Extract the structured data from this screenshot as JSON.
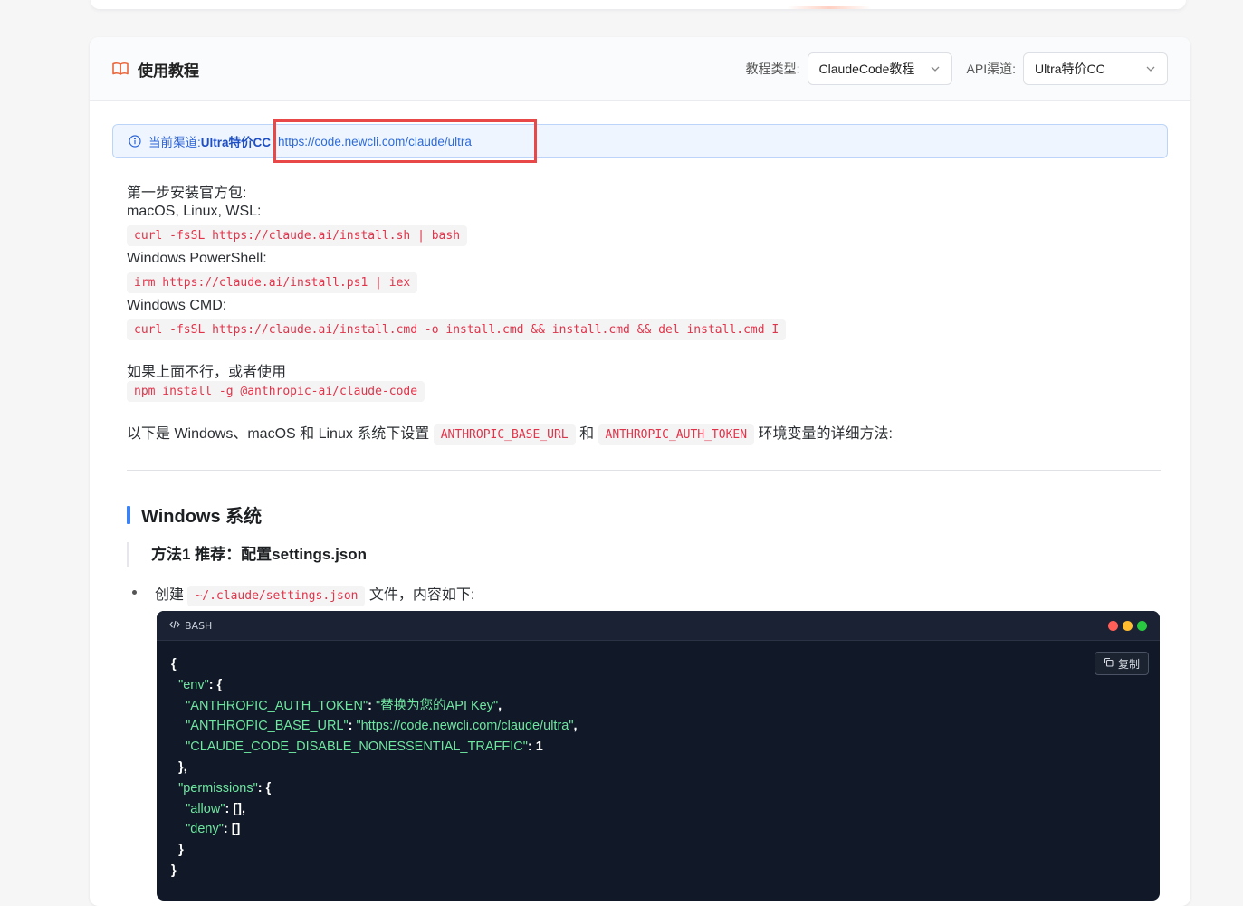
{
  "header": {
    "title": "使用教程",
    "tutorial_type_label": "教程类型:",
    "tutorial_type_value": "ClaudeCode教程",
    "api_channel_label": "API渠道:",
    "api_channel_value": "Ultra特价CC"
  },
  "channel": {
    "prefix": "当前渠道: ",
    "name": "Ultra特价CC",
    "url": "https://code.newcli.com/claude/ultra"
  },
  "install": {
    "step1": "第一步安装官方包:",
    "mac_label": "macOS, Linux, WSL:",
    "mac_cmd": "curl -fsSL https://claude.ai/install.sh | bash",
    "ps_label": "Windows PowerShell:",
    "ps_cmd": "irm https://claude.ai/install.ps1 | iex",
    "cmd_label": "Windows CMD:",
    "cmd_cmd": "curl -fsSL https://claude.ai/install.cmd -o install.cmd && install.cmd && del install.cmd I",
    "alt_label": "如果上面不行，或者使用",
    "npm_cmd": "npm install -g @anthropic-ai/claude-code",
    "env_intro_a": "以下是 Windows、macOS 和 Linux 系统下设置 ",
    "env_var_1": "ANTHROPIC_BASE_URL",
    "env_intro_b": " 和 ",
    "env_var_2": "ANTHROPIC_AUTH_TOKEN",
    "env_intro_c": " 环境变量的详细方法:"
  },
  "windows": {
    "heading": "Windows 系统",
    "method1": "方法1 推荐：配置settings.json",
    "create_a": "创建 ",
    "settings_path": "~/.claude/settings.json",
    "create_b": " 文件，内容如下:"
  },
  "code": {
    "lang": "BASH",
    "copy_label": "复制",
    "k_env": "\"env\"",
    "k_token": "\"ANTHROPIC_AUTH_TOKEN\"",
    "v_token": "\"替换为您的API Key\"",
    "k_base": "\"ANTHROPIC_BASE_URL\"",
    "v_base": "\"https://code.newcli.com/claude/ultra\"",
    "k_traffic": "\"CLAUDE_CODE_DISABLE_NONESSENTIAL_TRAFFIC\"",
    "v_traffic": "1",
    "k_perm": "\"permissions\"",
    "k_allow": "\"allow\"",
    "k_deny": "\"deny\""
  },
  "colors": {
    "accent_blue": "#3b82f6",
    "code_red": "#e0344a",
    "highlight_red": "#e84848",
    "dot_red": "#ff5f57",
    "dot_yellow": "#febc2e",
    "dot_green": "#28c840"
  }
}
